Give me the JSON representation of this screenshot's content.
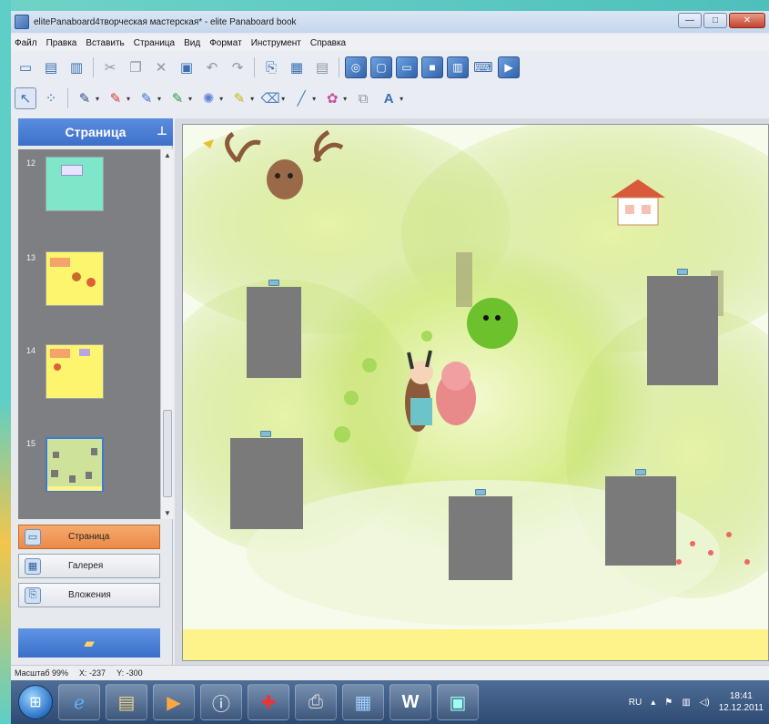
{
  "window": {
    "title": "elitePanaboard4творческая мастерская* - elite Panaboard book",
    "min_label": "—",
    "max_label": "□",
    "close_label": "✕"
  },
  "menu": [
    "Файл",
    "Правка",
    "Вставить",
    "Страница",
    "Вид",
    "Формат",
    "Инструмент",
    "Справка"
  ],
  "toolbar1": {
    "icons": [
      "new-page-icon",
      "open-icon",
      "save-icon",
      "cut-icon",
      "copy-icon",
      "delete-icon",
      "paste-icon",
      "undo-icon",
      "redo-icon",
      "import-icon",
      "export-icon",
      "print-icon",
      "capture-icon",
      "screen-icon",
      "blackboard-icon",
      "slide-icon",
      "recycle-icon",
      "keyboard-icon",
      "presentation-icon"
    ]
  },
  "toolbar2": {
    "icons": [
      "select-arrow-icon",
      "multi-select-icon",
      "pen-icon",
      "pen-red-icon",
      "pen-blue-icon",
      "pen-green-icon",
      "stamp-icon",
      "highlighter-icon",
      "eraser-icon",
      "line-icon",
      "shape-icon",
      "figure-icon",
      "text-a-icon"
    ]
  },
  "left_panel": {
    "header": "Страница",
    "pages": [
      {
        "num": "12"
      },
      {
        "num": "13"
      },
      {
        "num": "14"
      },
      {
        "num": "15"
      }
    ],
    "nav": {
      "page": "Страница",
      "gallery": "Галерея",
      "attachments": "Вложения"
    }
  },
  "status": {
    "zoom": "Масштаб 99%",
    "x": "X: -237",
    "y": "Y: -300"
  },
  "taskbar": {
    "lang": "RU",
    "time": "18:41",
    "date": "12.12.2011"
  },
  "colors": {
    "accent": "#3c70c8",
    "active_nav": "#ec8a48",
    "canvas_yellow": "#fdf38a",
    "placeholder_gray": "#7a7a7a"
  }
}
